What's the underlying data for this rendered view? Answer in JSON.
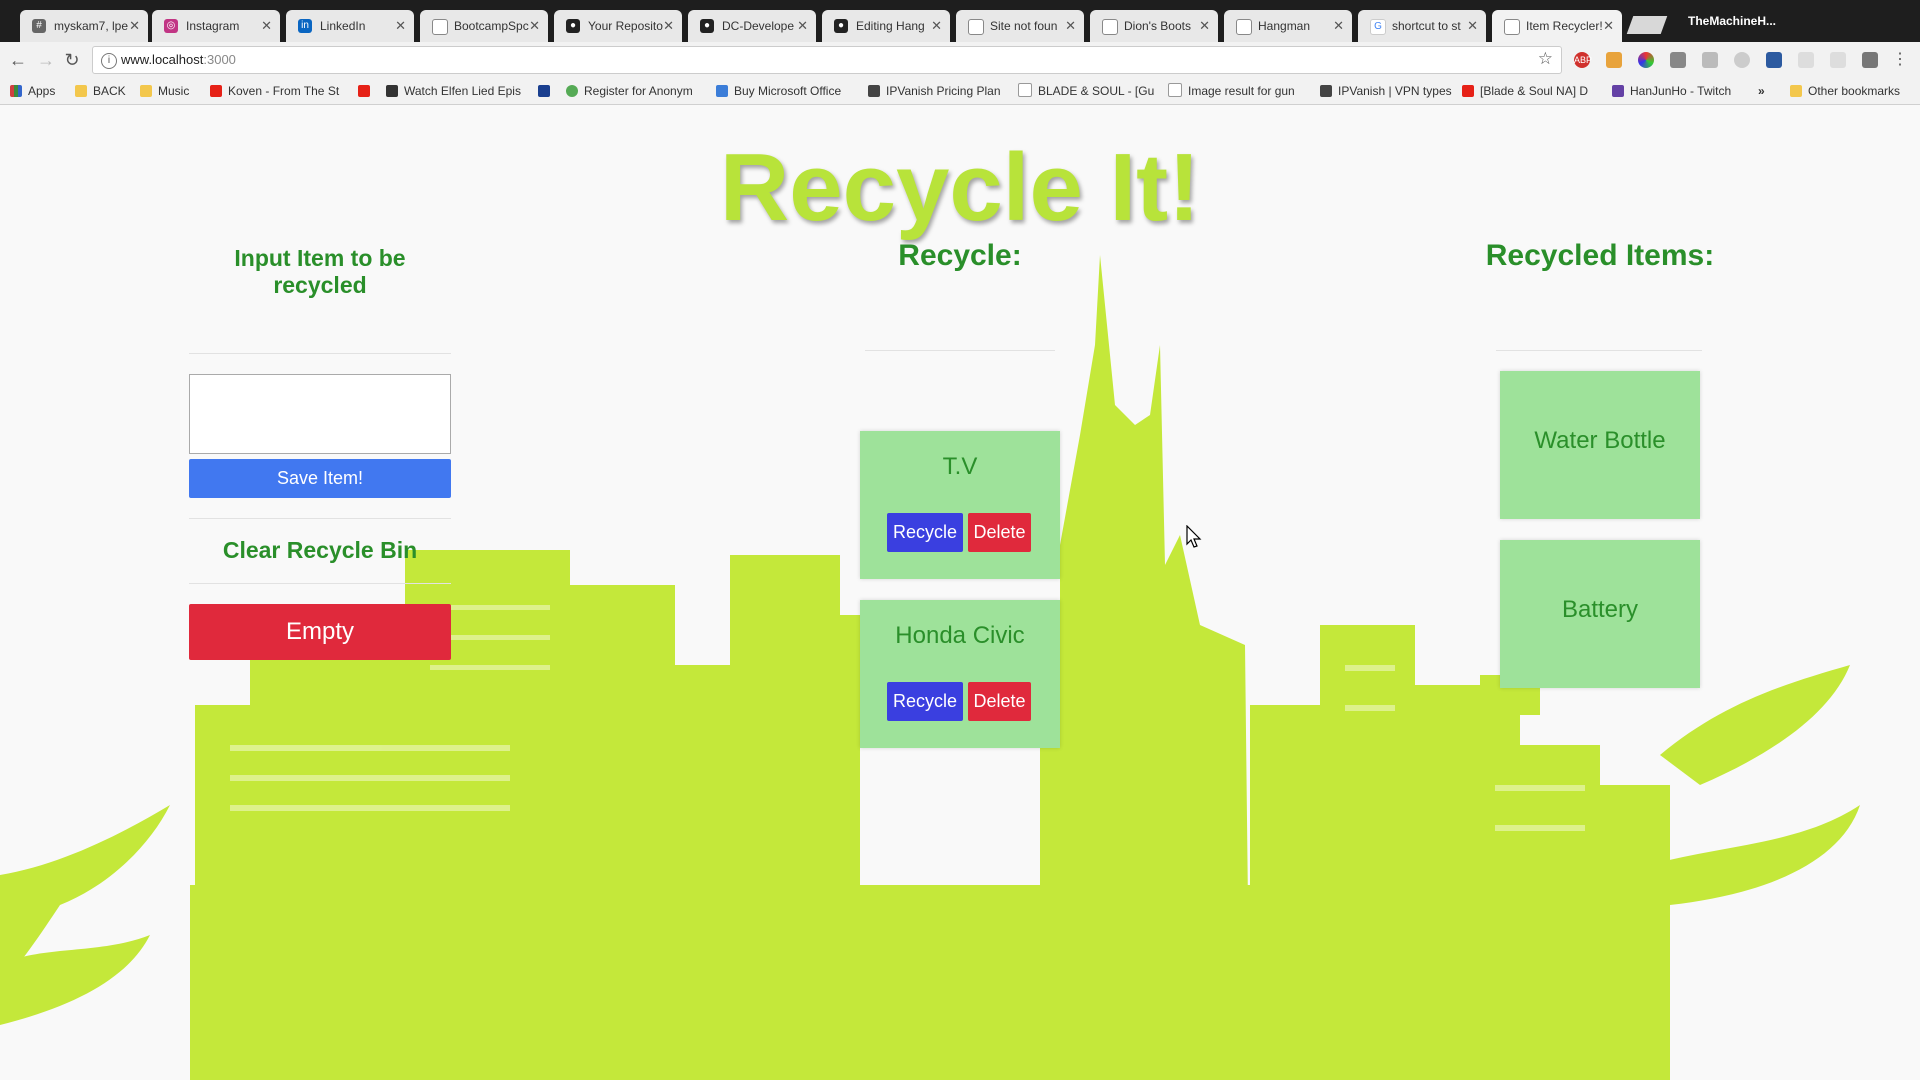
{
  "browser": {
    "tabs": [
      {
        "title": "myskam7, lpe",
        "icon": "#"
      },
      {
        "title": "Instagram",
        "icon": "◎"
      },
      {
        "title": "LinkedIn",
        "icon": "in"
      },
      {
        "title": "BootcampSpc",
        "icon": ""
      },
      {
        "title": "Your Reposito",
        "icon": "●"
      },
      {
        "title": "DC-Develope",
        "icon": "●"
      },
      {
        "title": "Editing Hang",
        "icon": "●"
      },
      {
        "title": "Site not foun",
        "icon": ""
      },
      {
        "title": "Dion's Boots",
        "icon": ""
      },
      {
        "title": "Hangman",
        "icon": ""
      },
      {
        "title": "shortcut to st",
        "icon": "G"
      },
      {
        "title": "Item Recycler!",
        "icon": ""
      }
    ],
    "profile_name": "TheMachineH...",
    "url_host": "www.localhost",
    "url_port": ":3000",
    "bookmarks": [
      {
        "label": "Apps",
        "color": "#d04040"
      },
      {
        "label": "BACK",
        "color": "#f3c74c"
      },
      {
        "label": "Music",
        "color": "#f3c74c"
      },
      {
        "label": "Koven - From The St",
        "color": "#e62117"
      },
      {
        "label": "",
        "color": "#e62117"
      },
      {
        "label": "Watch Elfen Lied Epis",
        "color": "#333333"
      },
      {
        "label": "",
        "color": "#1a3f8f"
      },
      {
        "label": "Register for Anonym",
        "color": "#55aa55"
      },
      {
        "label": "Buy Microsoft Office",
        "color": "#3b7dd8"
      },
      {
        "label": "IPVanish Pricing Plan",
        "color": "#444444"
      },
      {
        "label": "BLADE & SOUL - [Gu",
        "color": "#aaaaaa"
      },
      {
        "label": "Image result for gun",
        "color": "#aaaaaa"
      },
      {
        "label": "IPVanish | VPN types",
        "color": "#444444"
      },
      {
        "label": "[Blade & Soul NA] D",
        "color": "#e62117"
      },
      {
        "label": "HanJunHo - Twitch",
        "color": "#6441a5"
      },
      {
        "label": "»",
        "color": "transparent"
      },
      {
        "label": "Other bookmarks",
        "color": "#f3c74c"
      }
    ]
  },
  "page": {
    "title": "Recycle It!",
    "input_section": {
      "heading": "Input Item to be recycled",
      "input_value": "",
      "save_label": "Save Item!",
      "clear_heading": "Clear Recycle Bin",
      "empty_label": "Empty"
    },
    "recycle_section": {
      "heading": "Recycle:",
      "items": [
        {
          "name": "T.V",
          "recycle_label": "Recycle",
          "delete_label": "Delete"
        },
        {
          "name": "Honda Civic",
          "recycle_label": "Recycle",
          "delete_label": "Delete"
        }
      ]
    },
    "recycled_section": {
      "heading": "Recycled Items:",
      "items": [
        {
          "name": "Water Bottle"
        },
        {
          "name": "Battery"
        }
      ]
    },
    "colors": {
      "title": "#b8e33a",
      "heading": "#2a8f2a",
      "skyline": "#c4e83a",
      "card": "#9ee29a",
      "save_button": "#4178f0",
      "recycle_button": "#3a3fe0",
      "delete_button": "#e0293c"
    }
  }
}
